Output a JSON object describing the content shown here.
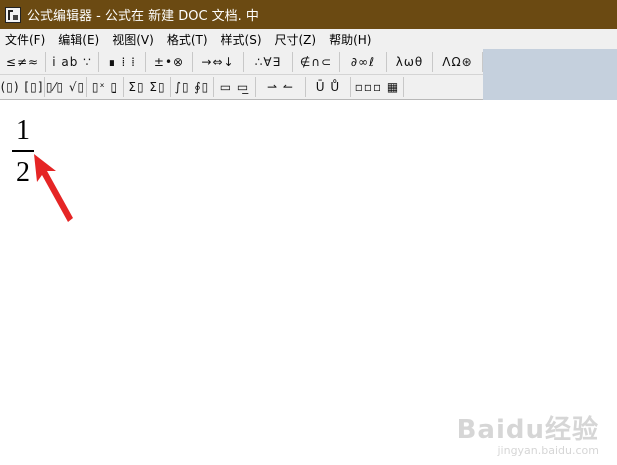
{
  "window": {
    "title": "公式编辑器 - 公式在 新建 DOC 文档. 中",
    "icon": "equation-editor-app-icon"
  },
  "menu": [
    {
      "label": "文件(F)",
      "name": "menu-file"
    },
    {
      "label": "编辑(E)",
      "name": "menu-edit"
    },
    {
      "label": "视图(V)",
      "name": "menu-view"
    },
    {
      "label": "格式(T)",
      "name": "menu-format"
    },
    {
      "label": "样式(S)",
      "name": "menu-style"
    },
    {
      "label": "尺寸(Z)",
      "name": "menu-size"
    },
    {
      "label": "帮助(H)",
      "name": "menu-help"
    }
  ],
  "toolbar": {
    "row1": [
      {
        "glyph": "≤≠≈",
        "name": "relational-symbols-palette-button"
      },
      {
        "glyph": "i ab ∵",
        "name": "spaces-ellipses-palette-button"
      },
      {
        "glyph": "∎ ⁞ ⁞",
        "name": "embellishments-palette-button"
      },
      {
        "glyph": "±•⊗",
        "name": "operator-symbols-palette-button"
      },
      {
        "glyph": "→⇔↓",
        "name": "arrow-symbols-palette-button"
      },
      {
        "glyph": "∴∀∃",
        "name": "logical-symbols-palette-button"
      },
      {
        "glyph": "∉∩⊂",
        "name": "set-theory-symbols-palette-button"
      },
      {
        "glyph": "∂∞ℓ",
        "name": "misc-symbols-palette-button"
      },
      {
        "glyph": "λωθ",
        "name": "greek-lowercase-palette-button"
      },
      {
        "glyph": "ΛΩ⊛",
        "name": "greek-uppercase-palette-button"
      }
    ],
    "row2": [
      {
        "glyph": "(▯) [▯]",
        "name": "fence-templates-palette-button"
      },
      {
        "glyph": "▯⁄▯ √▯",
        "name": "fraction-radical-templates-palette-button"
      },
      {
        "glyph": "▯ˣ ▯̱",
        "name": "subscript-superscript-templates-palette-button"
      },
      {
        "glyph": "Σ▯ Σ▯",
        "name": "summation-templates-palette-button"
      },
      {
        "glyph": "∫▯ ∮▯",
        "name": "integral-templates-palette-button"
      },
      {
        "glyph": "▭ ▭̲",
        "name": "underbar-overbar-templates-palette-button"
      },
      {
        "glyph": "⇀ ↼",
        "name": "labeled-arrow-templates-palette-button"
      },
      {
        "glyph": "Ū Ů",
        "name": "products-set-theory-templates-palette-button"
      },
      {
        "glyph": "▫▫▫ ▦",
        "name": "matrix-templates-palette-button"
      }
    ]
  },
  "formula": {
    "numerator": "1",
    "denominator": "2"
  },
  "watermark": {
    "main": "Baidu经验",
    "sub": "jingyan.baidu.com"
  }
}
